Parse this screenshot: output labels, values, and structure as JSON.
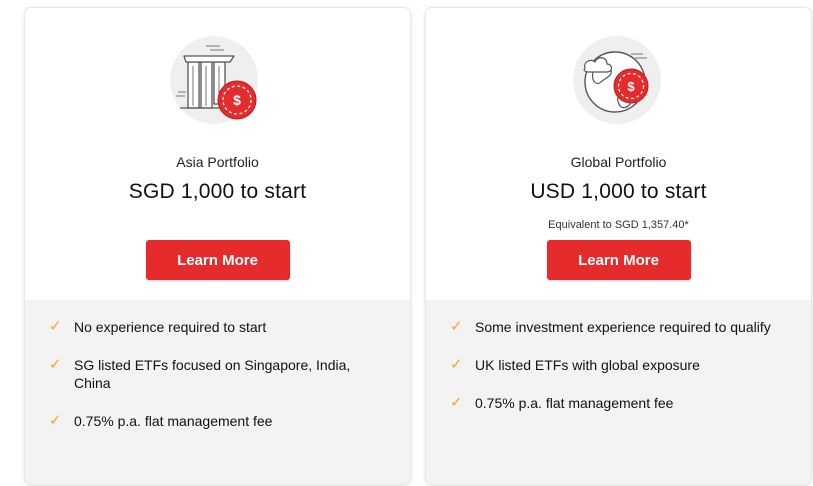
{
  "colors": {
    "accent": "#e62b2c",
    "check": "#f5a623",
    "feature_bg": "#f3f3f3"
  },
  "cards": [
    {
      "icon": "marina-bay-sands-coin-icon",
      "title": "Asia Portfolio",
      "headline": "SGD 1,000 to start",
      "note": "",
      "button_label": "Learn More",
      "features": [
        "No experience required to start",
        "SG listed ETFs focused on Singapore, India, China",
        "0.75% p.a. flat management fee"
      ]
    },
    {
      "icon": "globe-coin-icon",
      "title": "Global Portfolio",
      "headline": "USD 1,000 to start",
      "note": "Equivalent to SGD 1,357.40*",
      "button_label": "Learn More",
      "features": [
        "Some investment experience required to qualify",
        "UK listed ETFs with global exposure",
        "0.75% p.a. flat management fee"
      ]
    }
  ]
}
